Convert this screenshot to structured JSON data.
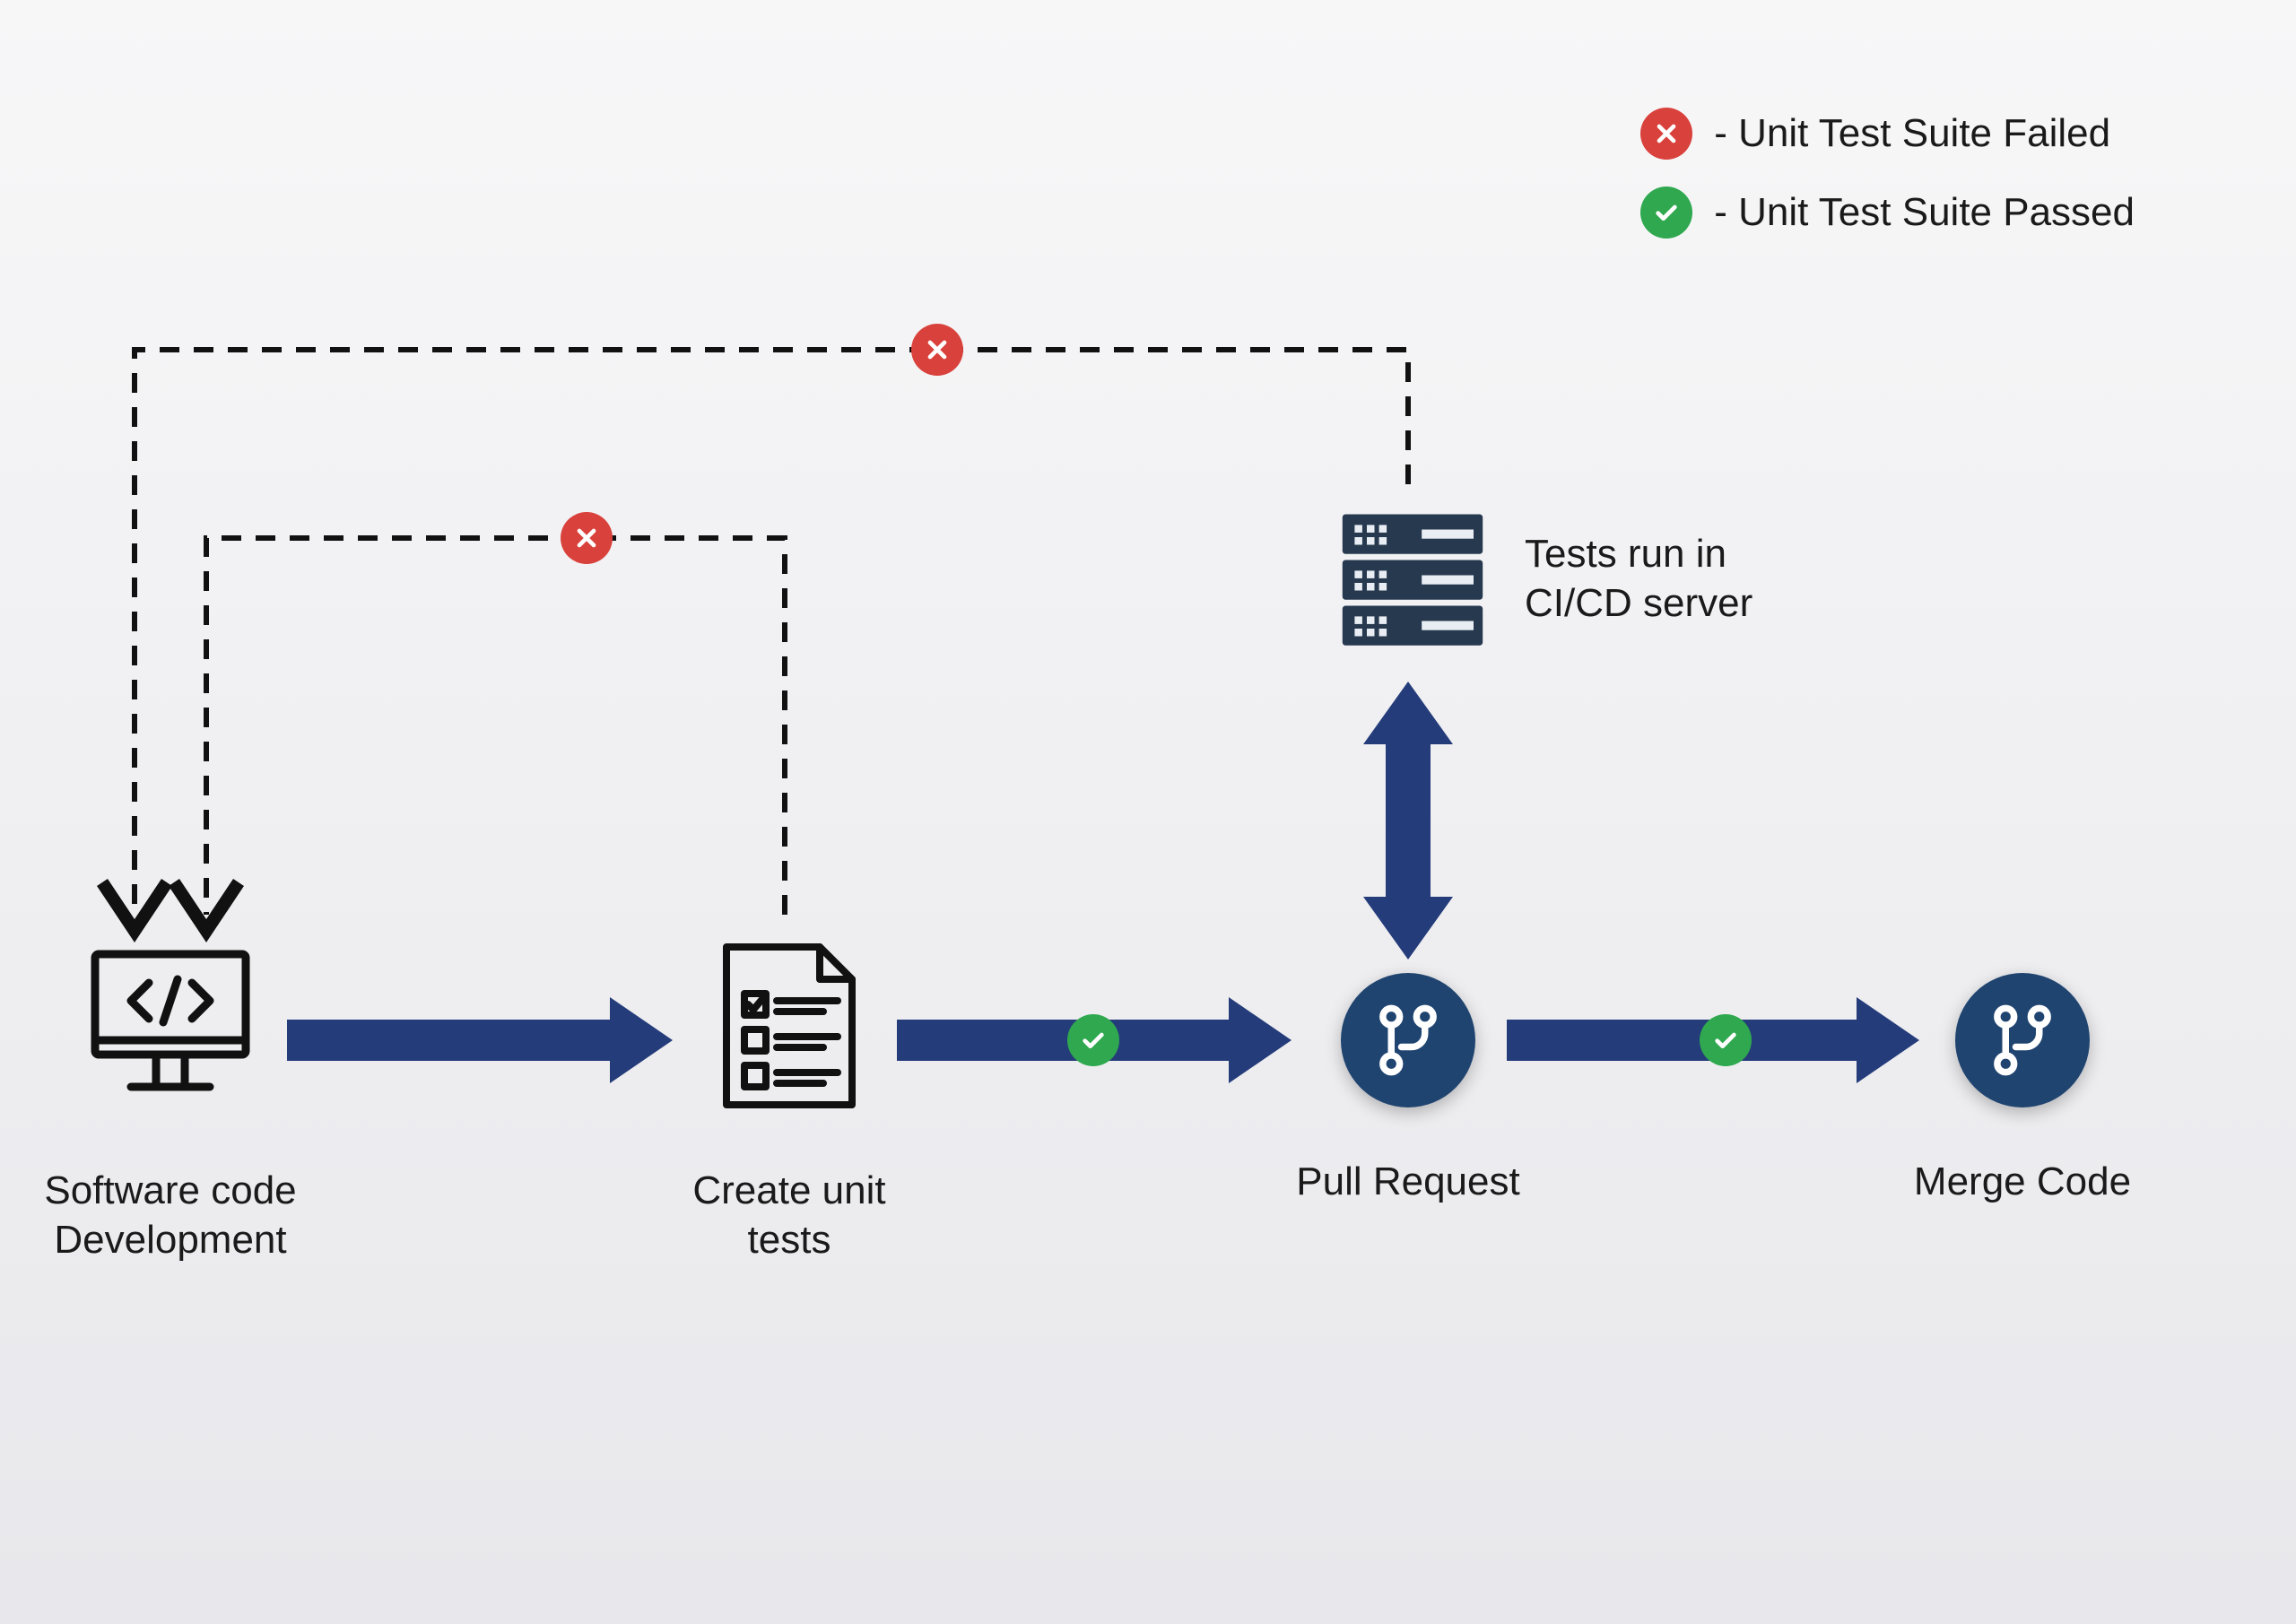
{
  "legend": {
    "failed": "- Unit Test Suite Failed",
    "passed": "- Unit Test Suite Passed"
  },
  "nodes": {
    "dev": "Software code\nDevelopment",
    "create": "Create unit\ntests",
    "pr": "Pull Request",
    "merge": "Merge Code",
    "ci": "Tests run in\nCI/CD server"
  },
  "colors": {
    "arrow": "#253c7a",
    "red": "#d9423c",
    "green": "#2fa84f",
    "circle": "#1f4470",
    "server": "#27394e"
  },
  "chart_data": {
    "type": "flowchart",
    "nodes": [
      {
        "id": "dev",
        "label": "Software code Development"
      },
      {
        "id": "create",
        "label": "Create unit tests"
      },
      {
        "id": "pr",
        "label": "Pull Request"
      },
      {
        "id": "merge",
        "label": "Merge Code"
      },
      {
        "id": "ci",
        "label": "Tests run in CI/CD server"
      }
    ],
    "edges": [
      {
        "from": "dev",
        "to": "create",
        "style": "solid"
      },
      {
        "from": "create",
        "to": "pr",
        "style": "solid",
        "status": "passed"
      },
      {
        "from": "pr",
        "to": "merge",
        "style": "solid",
        "status": "passed"
      },
      {
        "from": "pr",
        "to": "ci",
        "style": "solid-bidirectional"
      },
      {
        "from": "create",
        "to": "dev",
        "style": "dashed",
        "status": "failed"
      },
      {
        "from": "ci",
        "to": "dev",
        "style": "dashed",
        "status": "failed"
      }
    ],
    "legend": {
      "failed": "Unit Test Suite Failed",
      "passed": "Unit Test Suite Passed"
    }
  }
}
